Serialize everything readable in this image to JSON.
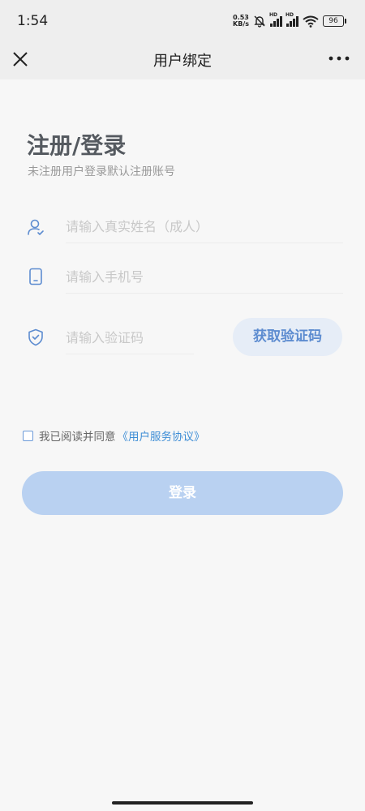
{
  "status_bar": {
    "time": "1:54",
    "speed_value": "0.53",
    "speed_unit": "KB/s",
    "hd_label_1": "HD",
    "hd_label_2": "HD",
    "battery": "96"
  },
  "nav": {
    "title": "用户绑定"
  },
  "form": {
    "title": "注册/登录",
    "subtitle": "未注册用户登录默认注册账号",
    "name_placeholder": "请输入真实姓名（成人）",
    "phone_placeholder": "请输入手机号",
    "code_placeholder": "请输入验证码",
    "get_code_label": "获取验证码",
    "agree_text": "我已阅读并同意",
    "agree_link": "《用户服务协议》",
    "login_label": "登录"
  },
  "colors": {
    "accent": "#5d8cd0",
    "login_button": "#b9d1f1",
    "link": "#3f8ed6"
  }
}
